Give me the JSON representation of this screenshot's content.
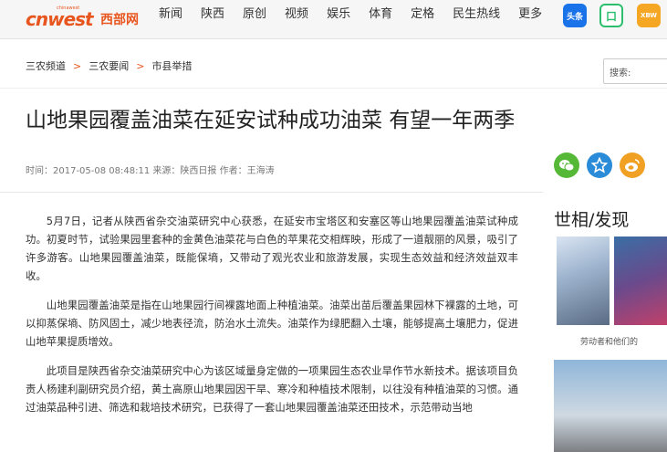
{
  "header": {
    "logo_main": "cnwest",
    "logo_cn": "西部网",
    "logo_tiny": "chinawest",
    "nav": [
      "新闻",
      "陕西",
      "原创",
      "视频",
      "娱乐",
      "体育",
      "定格",
      "民生热线",
      "更多"
    ],
    "apps": [
      {
        "icon": "toutiao-icon",
        "label": "头条"
      },
      {
        "icon": "app-icon",
        "label": "口"
      },
      {
        "icon": "weibo-app-icon",
        "label": "XBW"
      }
    ]
  },
  "breadcrumb": [
    "三农频道",
    "三农要闻",
    "市县举措"
  ],
  "search": {
    "placeholder": "搜索:"
  },
  "article": {
    "title": "山地果园覆盖油菜在延安试种成功油菜 有望一年两季",
    "meta": "时间：2017-05-08 08:48:11 来源：陕西日报 作者：王海涛",
    "paragraphs": [
      "5月7日，记者从陕西省杂交油菜研究中心获悉，在延安市宝塔区和安塞区等山地果园覆盖油菜试种成功。初夏时节，试验果园里套种的金黄色油菜花与白色的苹果花交相辉映，形成了一道靓丽的风景，吸引了许多游客。山地果园覆盖油菜，既能保墒，又带动了观光农业和旅游发展，实现生态效益和经济效益双丰收。",
      "山地果园覆盖油菜是指在山地果园行间裸露地面上种植油菜。油菜出苗后覆盖果园林下裸露的土地，可以抑蒸保墒、防风固土，减少地表径流，防治水土流失。油菜作为绿肥翻入土壤，能够提高土壤肥力，促进山地苹果提质增效。",
      "此项目是陕西省杂交油菜研究中心为该区域量身定做的一项果园生态农业旱作节水新技术。据该项目负责人杨建利副研究员介绍，黄土高原山地果园因干旱、寒冷和种植技术限制，以往没有种植油菜的习惯。通过油菜品种引进、筛选和栽培技术研究，已获得了一套山地果园覆盖油菜还田技术，示范带动当地"
    ]
  },
  "share": [
    {
      "icon": "wechat-icon"
    },
    {
      "icon": "star-icon"
    },
    {
      "icon": "weibo-icon"
    }
  ],
  "sidebar": {
    "title": "世相/发现",
    "caption": "劳动者和他们的",
    "colors": {
      "accent": "#e8561f"
    }
  }
}
